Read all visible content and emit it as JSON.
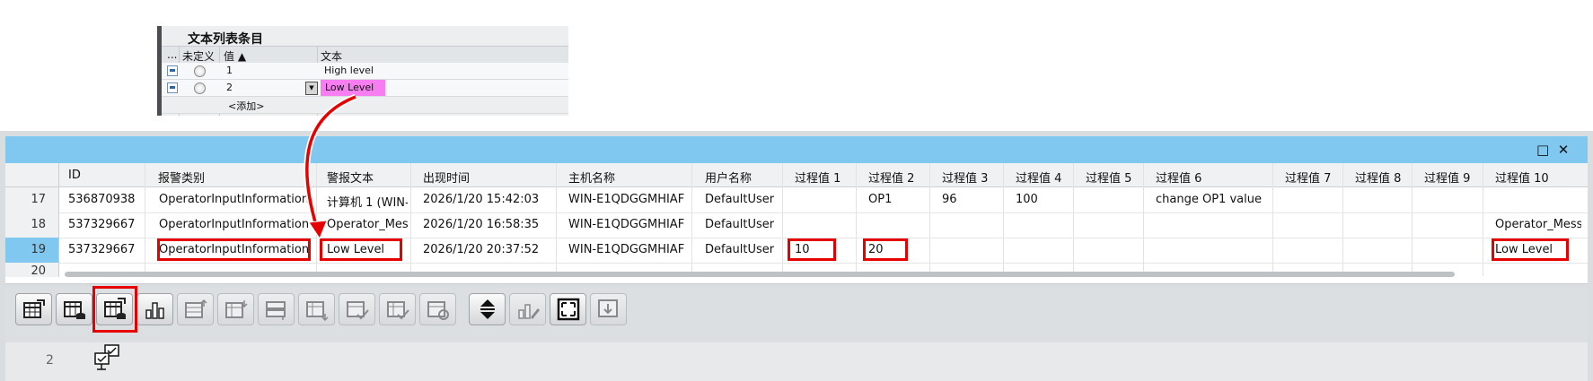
{
  "text_list_panel": {
    "title": "文本列表条目",
    "headers": {
      "dots": "...",
      "undefined": "未定义",
      "value": "值 ▲",
      "text": "文本"
    },
    "rows": [
      {
        "value": "1",
        "text": "High level"
      },
      {
        "value": "2",
        "text": "Low Level"
      }
    ],
    "add_label": "<添加>"
  },
  "alarm_view": {
    "window_buttons": {
      "maximize": "□",
      "close": "✕"
    },
    "columns": [
      "ID",
      "报警类别",
      "警报文本",
      "出现时间",
      "主机名称",
      "用户名称",
      "过程值 1",
      "过程值 2",
      "过程值 3",
      "过程值 4",
      "过程值 5",
      "过程值 6",
      "过程值 7",
      "过程值 8",
      "过程值 9",
      "过程值 10"
    ],
    "rows": [
      {
        "num": "17",
        "id": "536870938",
        "category": "OperatorInputInformation",
        "text": "计算机 1 (WIN-",
        "time": "2026/1/20 15:42:03",
        "host": "WIN-E1QDGGMHIAF",
        "user": "DefaultUser",
        "pv1": "",
        "pv2": "OP1",
        "pv3": "96",
        "pv4": "100",
        "pv5": "",
        "pv6": "change OP1 value",
        "pv7": "",
        "pv8": "",
        "pv9": "",
        "pv10": ""
      },
      {
        "num": "18",
        "id": "537329667",
        "category": "OperatorInputInformation",
        "text": "Operator_Mess",
        "time": "2026/1/20 16:58:35",
        "host": "WIN-E1QDGGMHIAF",
        "user": "DefaultUser",
        "pv1": "",
        "pv2": "",
        "pv3": "",
        "pv4": "",
        "pv5": "",
        "pv6": "",
        "pv7": "",
        "pv8": "",
        "pv9": "",
        "pv10": "Operator_Mess"
      },
      {
        "num": "19",
        "id": "537329667",
        "category": "OperatorInputInformation",
        "text": "Low Level",
        "time": "2026/1/20 20:37:52",
        "host": "WIN-E1QDGGMHIAF",
        "user": "DefaultUser",
        "pv1": "10",
        "pv2": "20",
        "pv3": "",
        "pv4": "",
        "pv5": "",
        "pv6": "",
        "pv7": "",
        "pv8": "",
        "pv9": "",
        "pv10": "Low Level"
      },
      {
        "num": "20",
        "id": "",
        "category": "",
        "text": "",
        "time": "",
        "host": "",
        "user": "",
        "pv1": "",
        "pv2": "",
        "pv3": "",
        "pv4": "",
        "pv5": "",
        "pv6": "",
        "pv7": "",
        "pv8": "",
        "pv9": "",
        "pv10": ""
      }
    ],
    "selected_row": "19",
    "status_number": "2"
  },
  "colors": {
    "title_bar": "#80c8f0",
    "highlight_box": "#e60000",
    "pink_cell": "#f77ef0"
  },
  "toolbar_icons": [
    "table-refresh-icon",
    "table-database-icon",
    "table-export-database-icon",
    "bar-chart-icon",
    "table-row-up-icon",
    "table-row-down-icon",
    "table-column-icon",
    "table-insert-icon",
    "table-check-icon",
    "table-check-alt-icon",
    "table-refresh-alt-icon",
    "sort-updown-icon",
    "edit-chart-icon",
    "fit-screen-icon",
    "export-icon"
  ]
}
